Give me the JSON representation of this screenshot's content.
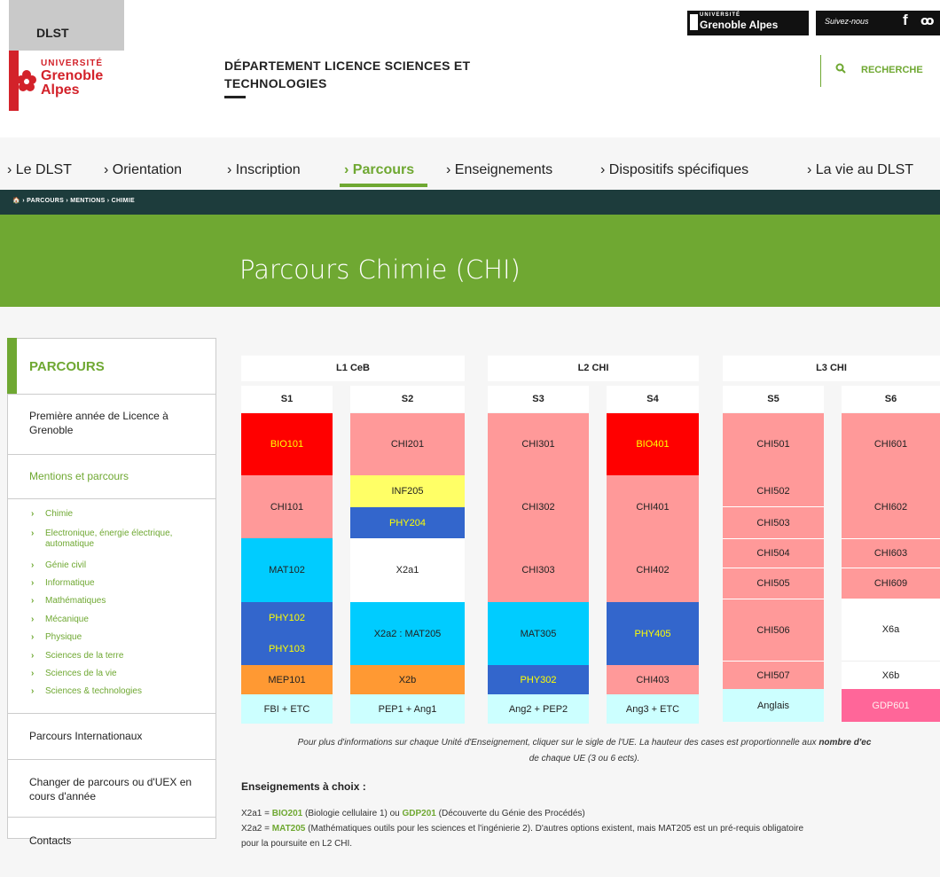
{
  "header": {
    "logo_dlst": "DLST",
    "logo_univ": "UNIVERSITÉ",
    "logo_grenoble": "Grenoble",
    "logo_alpes": "Alpes",
    "dept_line1": "DÉPARTEMENT LICENCE SCIENCES ET",
    "dept_line2": "TECHNOLOGIES",
    "uga_small": "UNIVERSITÉ",
    "uga_big": "Grenoble Alpes",
    "follow": "Suivez-nous",
    "facebook": "f",
    "rss": "ꚙ",
    "search_label": "RECHERCHE"
  },
  "nav": {
    "items": [
      {
        "label": "› Le DLST"
      },
      {
        "label": "› Orientation"
      },
      {
        "label": "› Inscription"
      },
      {
        "label": "› Parcours"
      },
      {
        "label": "› Enseignements"
      },
      {
        "label": "› Dispositifs spécifiques"
      },
      {
        "label": "› La vie au DLST"
      }
    ]
  },
  "breadcrumb": "🏠 › PARCOURS › MENTIONS › CHIMIE",
  "banner_title": "Parcours Chimie (CHI)",
  "sidebar": {
    "title": "PARCOURS",
    "item1": "Première année de Licence à Grenoble",
    "item2": "Mentions et parcours",
    "subs": [
      {
        "chev": "›",
        "label": "Chimie"
      },
      {
        "chev": "›",
        "label": "Electronique, énergie électrique, automatique"
      },
      {
        "chev": "›",
        "label": "Génie civil"
      },
      {
        "chev": "›",
        "label": "Informatique"
      },
      {
        "chev": "›",
        "label": "Mathématiques"
      },
      {
        "chev": "›",
        "label": "Mécanique"
      },
      {
        "chev": "›",
        "label": "Physique"
      },
      {
        "chev": "›",
        "label": "Sciences de la terre"
      },
      {
        "chev": "›",
        "label": "Sciences de la vie"
      },
      {
        "chev": "›",
        "label": "Sciences & technologies"
      }
    ],
    "item3": "Parcours Internationaux",
    "item4": "Changer de parcours ou d'UEX en cours d'année",
    "item5": "Contacts"
  },
  "table": {
    "years": [
      "L1 CeB",
      "L2 CHI",
      "L3 CHI"
    ],
    "semesters": [
      "S1",
      "S2",
      "S3",
      "S4",
      "S5",
      "S6"
    ],
    "colors": {
      "red": "#ff0000",
      "pink": "#ff9999",
      "cyan": "#00ccff",
      "blue": "#3366cc",
      "yellow": "#ffff66",
      "orange": "#ff9933",
      "lightcyan": "#ccffff",
      "hotpink": "#ff6699",
      "white": "#ffffff"
    },
    "cells": {
      "s1": [
        "BIO101",
        "CHI101",
        "MAT102",
        "PHY102",
        "PHY103",
        "MEP101",
        "FBI + ETC"
      ],
      "s2": [
        "CHI201",
        "INF205",
        "PHY204",
        "X2a1",
        "X2a2 : MAT205",
        "X2b",
        "PEP1 + Ang1"
      ],
      "s3": [
        "CHI301",
        "CHI302",
        "CHI303",
        "MAT305",
        "PHY302",
        "Ang2 + PEP2"
      ],
      "s4": [
        "BIO401",
        "CHI401",
        "CHI402",
        "PHY405",
        "CHI403",
        "Ang3 + ETC"
      ],
      "s5": [
        "CHI501",
        "CHI502",
        "CHI503",
        "CHI504",
        "CHI505",
        "CHI506",
        "CHI507",
        "Anglais"
      ],
      "s6": [
        "CHI601",
        "CHI602",
        "CHI603",
        "CHI609",
        "X6a",
        "X6b",
        "GDP601"
      ]
    }
  },
  "note": {
    "text1": "Pour plus d'informations sur chaque Unité d'Enseignement, cliquer sur le sigle de l'UE. La hauteur des cases est proportionnelle aux ",
    "bold": "nombre d'ec",
    "text2": "de chaque UE (3 ou 6 ects)."
  },
  "choices": {
    "title": "Enseignements à choix :",
    "l1a": "X2a1 = ",
    "l1b": "BIO201",
    "l1c": " (Biologie cellulaire 1) ou ",
    "l1d": "GDP201",
    "l1e": " (Découverte du Génie des Procédés)",
    "l2a": "X2a2 = ",
    "l2b": "MAT205",
    "l2c": " (Mathématiques outils pour les sciences et l'ingénierie 2). D'autres options existent, mais MAT205 est un pré-requis obligatoire",
    "l3": "pour la poursuite en L2 CHI."
  }
}
